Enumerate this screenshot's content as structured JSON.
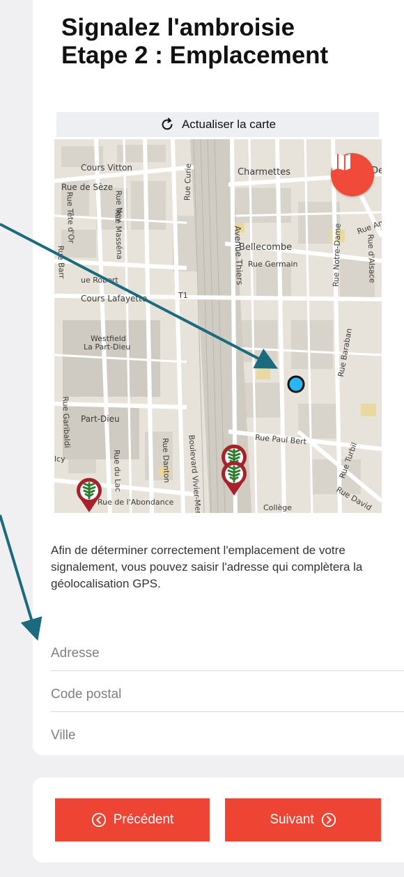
{
  "header": {
    "title_line1": "Signalez l'ambroisie",
    "title_line2": "Etape 2 : Emplacement"
  },
  "map": {
    "refresh_label": "Actualiser la carte",
    "refresh_icon": "refresh-icon",
    "layers_icon": "map-layers-icon",
    "street_labels": {
      "cours_vitton": "Cours Vitton",
      "rue_seze": "Rue de Sèze",
      "rue_tete_dor": "Rue Tête d'Or",
      "rue_ney": "Rue Ney",
      "rue_massena": "Rue Masséna",
      "rue_curie": "Rue Curie",
      "charmettes": "Charmettes",
      "dec": "Dec",
      "rue_an": "Rue An",
      "bellecombe": "Bellecombe",
      "rue_germain": "Rue Germain",
      "avenue_thiers": "Avenue Thiers",
      "rue_notre_dame": "Rue Notre-Dame",
      "rue_alsace": "Rue d'Alsace",
      "rue_robert": "ue Robert",
      "rue_barr": "Rue Barr",
      "cours_lafayette": "Cours Lafayette",
      "t1": "T1",
      "westfield": "Westfield",
      "la_part_dieu": "La Part-Dieu",
      "rue_baraban": "Rue Baraban",
      "rue_garibaldi": "Rue Garibaldi",
      "part_dieu": "Part-Dieu",
      "rue_paul_bert": "Rue Paul Bert",
      "rue_turbil": "Rue Turbil",
      "rue_danton": "Rue Danton",
      "bd_vivier_merle": "Boulevard Vivier-Merle",
      "rue_du_lac": "Rue du Lac",
      "rue_abondance": "Rue de l'Abondance",
      "rue_david": "Rue David",
      "college": "Collège",
      "lcy": "lcy"
    }
  },
  "info_text": "Afin de déterminer correctement l'emplacement de votre signalement, vous pouvez saisir l'adresse qui complètera la géolocalisation GPS.",
  "form": {
    "address_placeholder": "Adresse",
    "postal_placeholder": "Code postal",
    "city_placeholder": "Ville"
  },
  "nav": {
    "prev_label": "Précédent",
    "next_label": "Suivant",
    "prev_icon": "chevron-left-circle-icon",
    "next_icon": "chevron-right-circle-icon"
  },
  "colors": {
    "accent": "#ee4433",
    "location_dot": "#29b6f6",
    "marker": "#a8202a",
    "annotation_arrow": "#1a6b7e"
  }
}
